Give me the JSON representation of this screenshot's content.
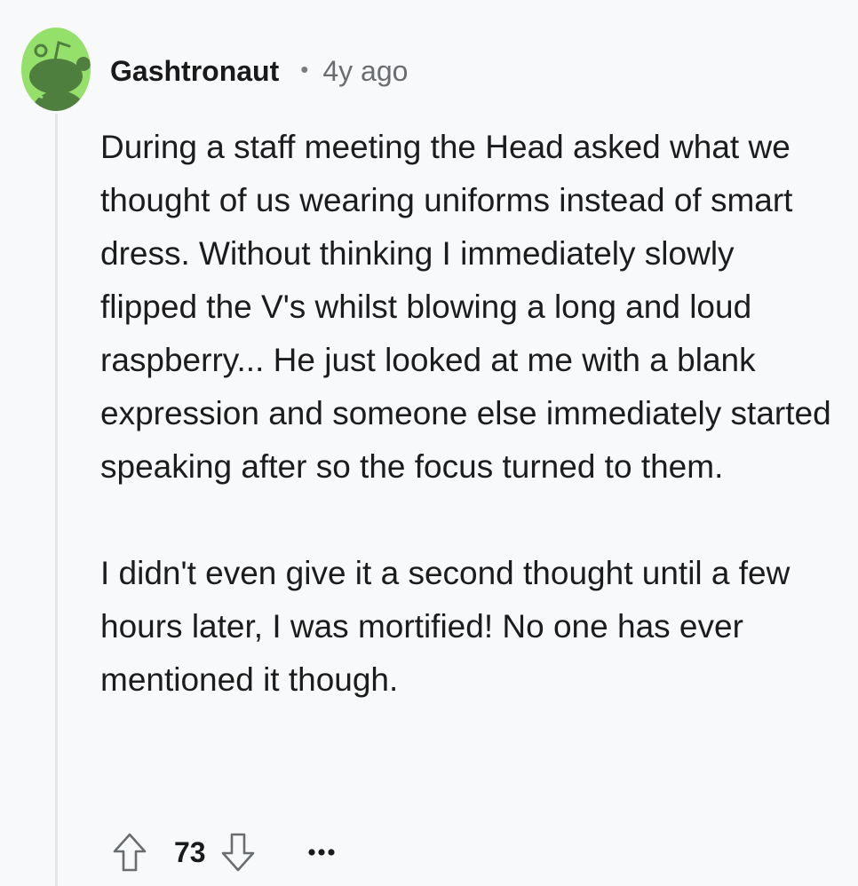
{
  "comment": {
    "username": "Gashtronaut",
    "separator": "•",
    "timestamp": "4y ago",
    "paragraphs": [
      "During a staff meeting the Head asked what we thought of us wearing uniforms instead of smart dress. Without thinking I immediately slowly flipped the V's whilst blowing a long and loud raspberry... He just looked at me with a blank expression and someone else immediately started speaking after so the focus turned to them.",
      "I didn't even give it a second thought until a few hours later, I was mortified! No one has ever mentioned it though."
    ],
    "score": "73"
  },
  "icons": {
    "avatar": "reddit-snoo-avatar-icon",
    "upvote": "upvote-arrow-icon",
    "downvote": "downvote-arrow-icon",
    "more": "ellipsis-icon"
  },
  "colors": {
    "background": "#f8f9fa",
    "avatar_bg": "#94e06b",
    "avatar_snoo": "#4f7f3e",
    "thread_line": "#e4e6e8",
    "meta_text": "#6a6d70"
  }
}
